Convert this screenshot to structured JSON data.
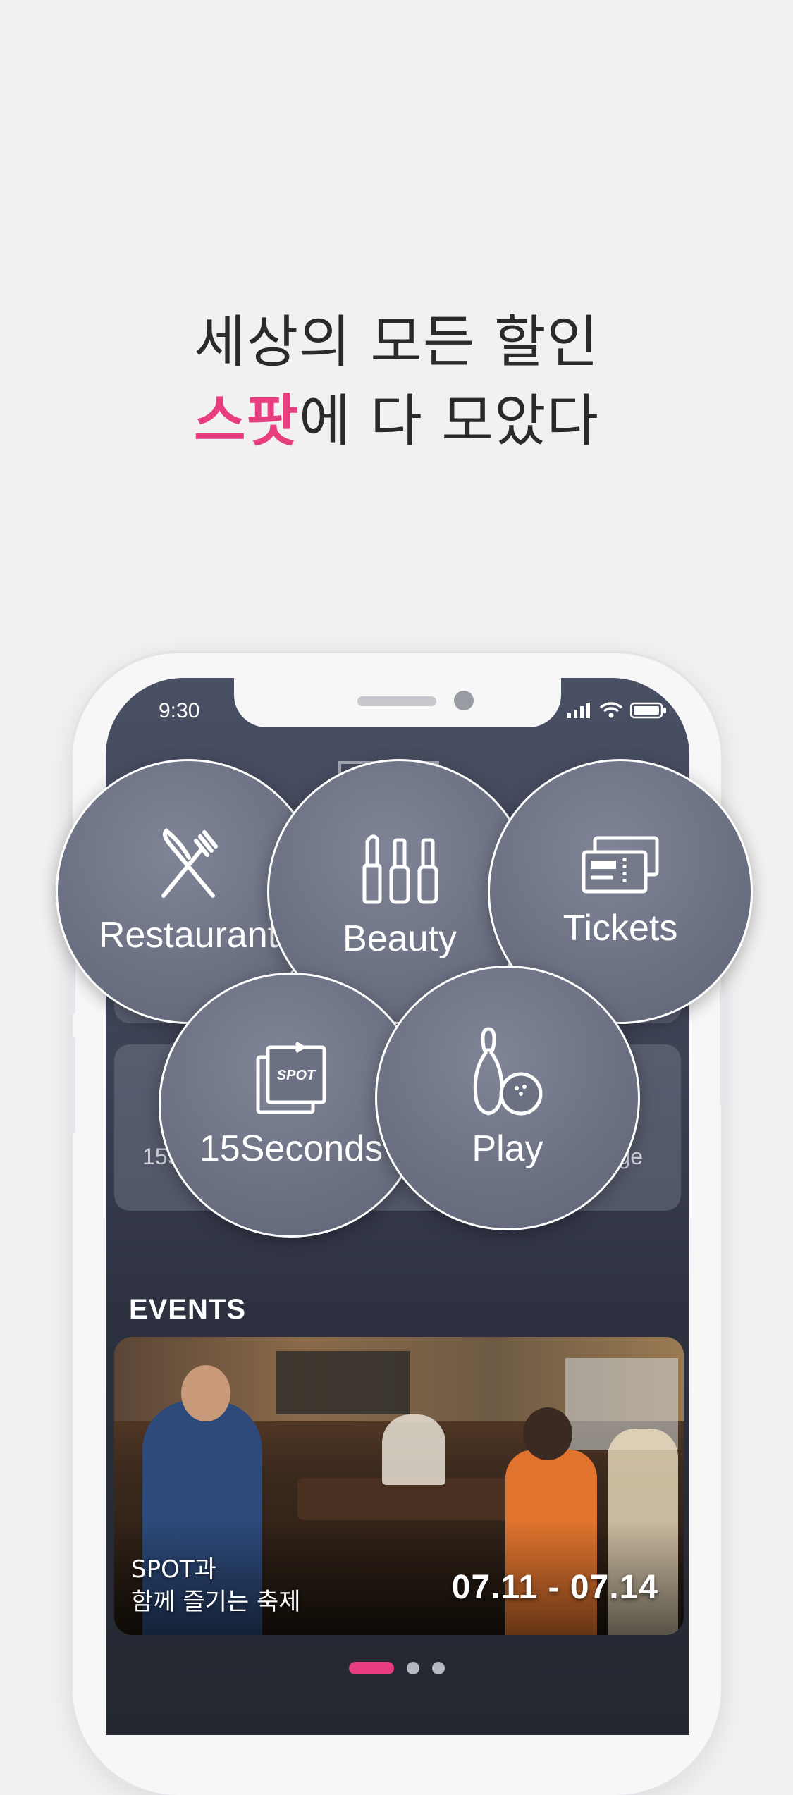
{
  "headline": {
    "line1": "세상의 모든 할인",
    "line2_accent": "스팟",
    "line2_rest": "에 다 모았다"
  },
  "status_bar": {
    "time": "9:30",
    "icons": [
      "signal-icon",
      "wifi-icon",
      "battery-icon"
    ]
  },
  "background_cards": {
    "left_label_fragment": "15S",
    "right_label_fragment": "age"
  },
  "categories": [
    {
      "name": "restaurant",
      "label": "Restaurant",
      "icon": "fork-knife-icon"
    },
    {
      "name": "beauty",
      "label": "Beauty",
      "icon": "cosmetics-icon"
    },
    {
      "name": "tickets",
      "label": "Tickets",
      "icon": "tickets-icon"
    },
    {
      "name": "15seconds",
      "label": "15Seconds",
      "icon": "spot-cards-icon",
      "icon_text": "SPOT"
    },
    {
      "name": "play",
      "label": "Play",
      "icon": "bowling-icon"
    }
  ],
  "events": {
    "title": "EVENTS",
    "card": {
      "text_line1": "SPOT과",
      "text_line2": "함께 즐기는 축제",
      "date": "07.11 - 07.14"
    }
  },
  "pagination": {
    "total": 3,
    "active": 1
  },
  "colors": {
    "accent": "#e83d7e",
    "background": "#f1f1f1",
    "screen_dark": "#2d3140"
  }
}
